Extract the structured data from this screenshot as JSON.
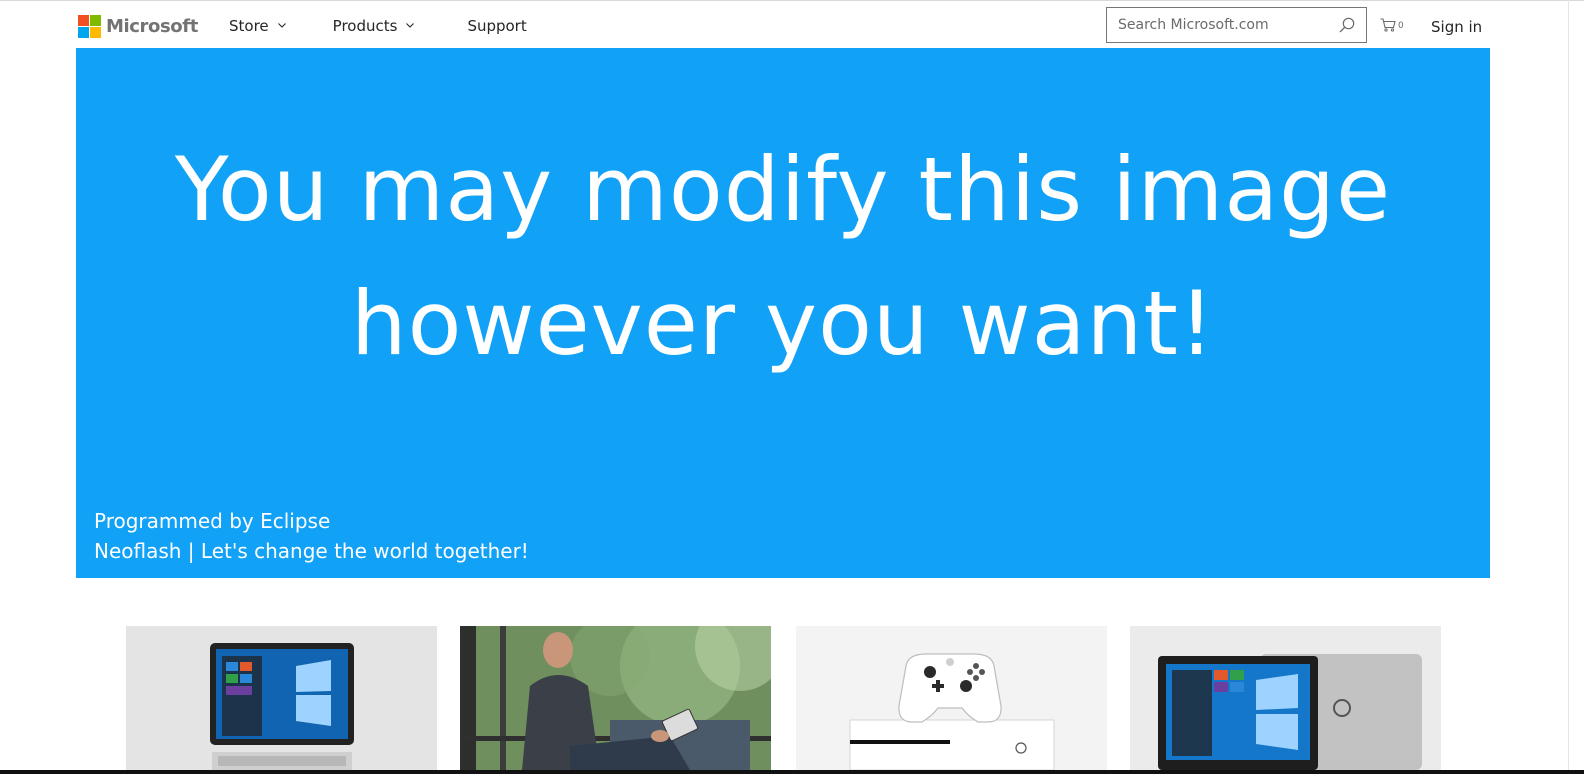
{
  "header": {
    "logo_text": "Microsoft",
    "logo_colors": [
      "#f25022",
      "#7fba00",
      "#00a4ef",
      "#ffb900"
    ],
    "nav": [
      {
        "label": "Store",
        "has_dropdown": true
      },
      {
        "label": "Products",
        "has_dropdown": true
      },
      {
        "label": "Support",
        "has_dropdown": false
      }
    ],
    "search_placeholder": "Search Microsoft.com",
    "search_icon": "search-icon",
    "cart_icon": "cart-icon",
    "cart_count": "0",
    "sign_in": "Sign in"
  },
  "hero": {
    "background": "#11a1f6",
    "line1": "You may modify this image",
    "line2": "however you want!",
    "credit1": "Programmed by Eclipse",
    "credit2": "Neoflash | Let's change the world together!"
  },
  "tiles": [
    {
      "name": "surface-pro-tile"
    },
    {
      "name": "man-with-tablet-tile"
    },
    {
      "name": "xbox-one-s-tile"
    },
    {
      "name": "dell-laptop-tile"
    }
  ]
}
